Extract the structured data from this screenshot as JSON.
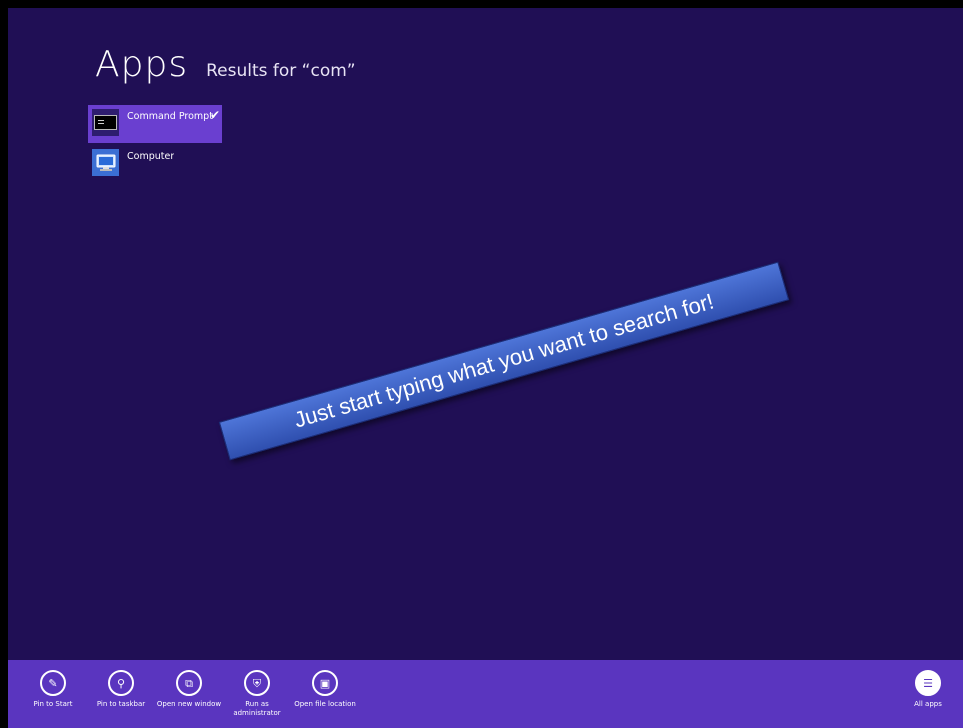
{
  "header": {
    "title": "Apps",
    "results_label": "Results for “com”"
  },
  "results": [
    {
      "label": "Command Prompt",
      "icon": "command-prompt-icon",
      "selected": true
    },
    {
      "label": "Computer",
      "icon": "computer-icon",
      "selected": false
    }
  ],
  "banner": {
    "text": "Just start typing what you want to search for!"
  },
  "app_bar": {
    "pin_start": "Pin to Start",
    "pin_taskbar": "Pin to taskbar",
    "open_new_window": "Open new window",
    "run_as_admin": "Run as administrator",
    "open_file_location": "Open file location",
    "all_apps": "All apps"
  },
  "colors": {
    "background": "#200f55",
    "app_bar": "#5a35bf",
    "selected": "#6a3fd0",
    "banner": "#3a5fc4"
  }
}
